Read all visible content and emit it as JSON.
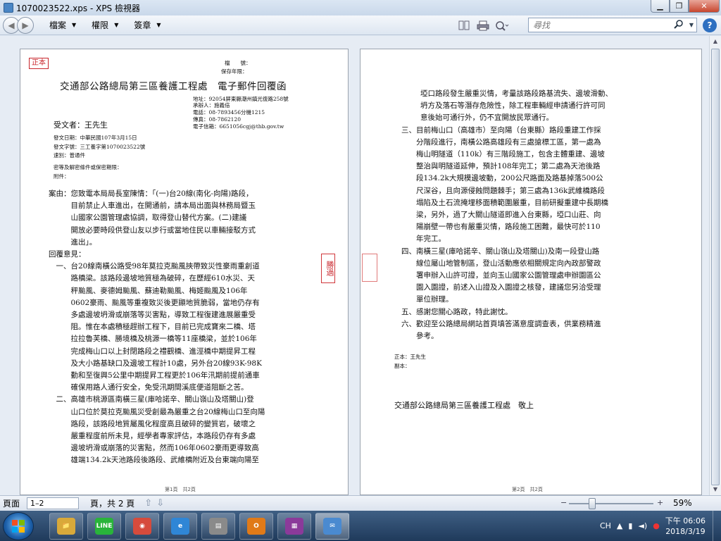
{
  "window": {
    "title": "1070023522.xps - XPS 檢視器",
    "minimize": "▁",
    "maximize": "❐",
    "close": "✕"
  },
  "toolbar": {
    "back": "◀",
    "forward": "▶",
    "menus": [
      "檔案",
      "權限",
      "簽章"
    ],
    "caret": "▼",
    "search_placeholder": "尋找",
    "search_icon": "search-icon",
    "help": "?"
  },
  "page1": {
    "stamp": "正本",
    "file_no": "檔　　號：",
    "retention": "保存年限：",
    "title": "交通部公路總局第三區養護工程處　電子郵件回覆函",
    "address": "地址：92054屏東縣潮州鎮光復路258號",
    "contact": "承辦人：施義倍",
    "phone": "電話：08-7893456分機1215",
    "fax": "傳真：08-7862120",
    "email": "電子信箱：6651056cgj@thb.gov.tw",
    "recipient": "受文者：王先生",
    "date": "發文日期：中華民國107年3月15日",
    "doc_no": "發文字號：三工養字第1070023522號",
    "speed": "速別：普通件",
    "secrecy": "密等及解密條件或保密期限：",
    "attachment": "附件：",
    "body": [
      "案由：您致電本局局長室陳情：「(一)台20線(南化-向陽)路段，",
      "　　　目前禁止人車進出，在開通前，請本局出面與林務局暨玉",
      "　　　山國家公園管理處協調，取得登山替代方案。(二)建議",
      "　　　開放必要時段供登山友以步行或當地住民以車輛接駁方式",
      "　　　進出」。",
      "回覆意見：",
      "　一、台20線南橫公路受98年莫拉克颱風挾帶致災性豪雨重創道",
      "　　　路橋梁。該路段邊坡地質極為破碎，在歷經610水災、天",
      "　　　秤颱風、麥德姆颱風、蘇迪勒颱風、梅姬颱風及106年",
      "　　　0602豪雨、颱風等重複致災後更顯地質脆弱，當地仍存有",
      "　　　多處邊坡坍滑或崩落等災害點，導致工程復建進展嚴重受",
      "　　　阻。惟在本處積極趕辦工程下，目前已完成寶來二橋、塔",
      "　　　拉拉魯芙橋、勝境橋及桃源一橋等11座橋梁，並於106年",
      "　　　完成梅山口以上封閉路段之禮觀橋、進涇橋中期提昇工程",
      "　　　及大小路基缺口及邊坡工程計10處，另外台20線93K-98K",
      "　　　勤和至復興5公里中期提昇工程更於106年汛期前提前通車",
      "　　　確保用路人通行安全，免受汛期間溪底便道阻斷之苦。",
      "　二、高雄市桃源區南橫三星(庫哈諾辛、關山嶺山及塔關山)登",
      "　　　山口位於莫拉克颱風災受創最為嚴重之台20線梅山口至向陽",
      "　　　路段，該路段地質屬風化程度高且破碎的變質岩，破壞之",
      "　　　嚴重程度前所未見，經學者專家評估，本路段仍存有多處",
      "　　　邊坡坍滑或崩落的災害點，然而106年0602豪雨更導致高",
      "　　　雄端134.2k天池路段後路段、武維橋附近及台東端向陽至"
    ],
    "margin_mark": "勝過",
    "page_no": "第1頁　共2頁"
  },
  "page2": {
    "body": [
      "埡口路段發生嚴重災情，考量該路段路基流失、邊坡滑動、",
      "坍方及落石等潛存危險性，除工程車輛經申請通行許可同",
      "意後始可通行外，仍不宜開放民眾通行。",
      "三、目前梅山口（高雄市）至向陽（台東縣）路段重建工作採",
      "　　分階段進行，南橫公路高雄段有三處搶標工區，第一處為",
      "　　梅山明隧道（110k）有三階段施工，包含主體重建、邊坡",
      "　　整治與明隧道延伸，預計108年完工；第二處為天池後路",
      "　　段134.2k大規模邊坡動，200公尺路面及路基掉落500公",
      "　　尺深谷，且向源侵蝕問題棘手；第三處為136k武維橋路段",
      "　　塌陷及土石流掩埋移面積範圍嚴重，目前研擬重建中長期橋",
      "　　梁，另外，過了大關山隧道即進入台東縣，埡口山莊、向",
      "　　陽崩壁一帶也有嚴重災情，路段施工困難，最快可於110",
      "　　年完工。",
      "四、南橫三星(庫哈諾辛、關山嶺山及塔關山)及南一段登山路",
      "　　線位屬山地管制區，登山活動應依相關規定向內政部警政",
      "　　署申辦入山許可證，並向玉山國家公園管理處申辦園區公",
      "　　園入園證，前述入山證及入園證之核發，建議您另洽受理",
      "　　單位辦理。",
      "五、感謝您關心路政，特此謝忱。",
      "六、歡迎至公路總局網站首頁填答滿意度調查表，供業務精進",
      "　　參考。"
    ],
    "cc_main": "正本：王先生",
    "cc_copy": "副本：",
    "signature": "交通部公路總局第三區養護工程處　敬上",
    "page_no": "第2頁　共2頁"
  },
  "statusbar": {
    "page_label": "頁面",
    "page_value": "1–2",
    "of_label": "頁，共 2 頁",
    "zoom_minus": "−",
    "zoom_plus": "+",
    "zoom": "59%"
  },
  "taskbar": {
    "apps": [
      {
        "name": "explorer",
        "label": "📁",
        "color": "#d9a93a"
      },
      {
        "name": "line",
        "label": "LINE",
        "color": "#29b43a"
      },
      {
        "name": "chrome",
        "label": "◉",
        "color": "#d64b3c"
      },
      {
        "name": "ie",
        "label": "e",
        "color": "#2f86d6"
      },
      {
        "name": "scanner",
        "label": "▤",
        "color": "#8a8a8a"
      },
      {
        "name": "outlook",
        "label": "O",
        "color": "#e07a18"
      },
      {
        "name": "winrar",
        "label": "▦",
        "color": "#8b3a9a"
      },
      {
        "name": "xps-viewer",
        "label": "✉",
        "color": "#4a8ad0"
      }
    ],
    "lang": "CH",
    "time": "下午 06:06",
    "date": "2018/3/19"
  }
}
